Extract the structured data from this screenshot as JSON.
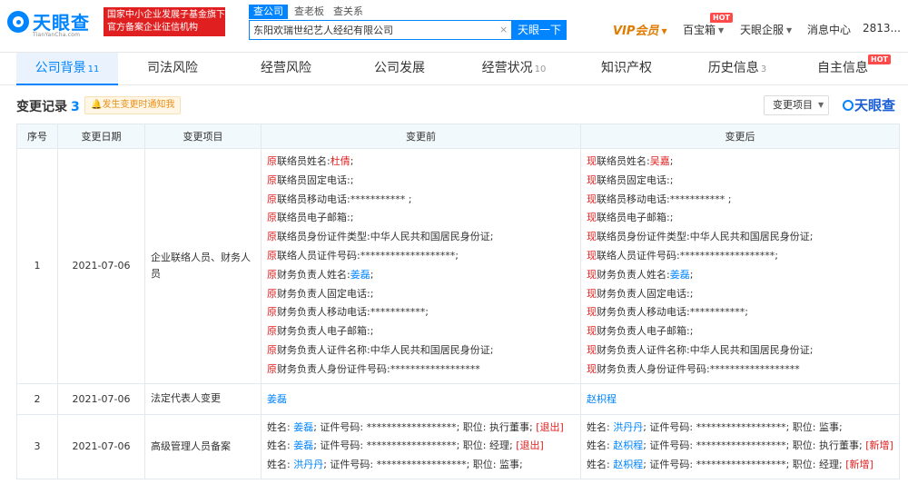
{
  "header": {
    "logo_text": "天眼查",
    "logo_sub": "TianYanCha.com",
    "banner_line1": "国家中小企业发展子基金旗下",
    "banner_line2": "官方备案企业征信机构",
    "search_tabs": [
      "查公司",
      "查老板",
      "查关系"
    ],
    "search_value": "东阳欢瑞世纪艺人经纪有限公司",
    "search_clear": "×",
    "search_button": "天眼一下",
    "nav": {
      "vip": "VIP会员",
      "treasure": "百宝箱",
      "treasure_badge": "HOT",
      "enterprise": "天眼企服",
      "messages": "消息中心",
      "user": "2813..."
    }
  },
  "tabs": [
    {
      "label": "公司背景",
      "count": "11"
    },
    {
      "label": "司法风险",
      "count": ""
    },
    {
      "label": "经营风险",
      "count": ""
    },
    {
      "label": "公司发展",
      "count": ""
    },
    {
      "label": "经营状况",
      "count": "10"
    },
    {
      "label": "知识产权",
      "count": ""
    },
    {
      "label": "历史信息",
      "count": "3"
    },
    {
      "label": "自主信息",
      "count": "",
      "badge": "HOT"
    }
  ],
  "section": {
    "title": "变更记录",
    "count": "3",
    "notify_button": "发生变更时通知我",
    "filter_button": "变更项目",
    "watermark": "天眼查"
  },
  "table": {
    "headers": [
      "序号",
      "变更日期",
      "变更项目",
      "变更前",
      "变更后"
    ],
    "rows": [
      {
        "index": "1",
        "date": "2021-07-06",
        "item": "企业联络人员、财务人员",
        "before_prefix": "原",
        "after_prefix": "现",
        "before": [
          {
            "text": "联络员姓名:",
            "name": "杜倩",
            "name_style": "red",
            "tail": ";"
          },
          {
            "text": "联络员固定电话:;"
          },
          {
            "text": "联络员移动电话:*********** ;"
          },
          {
            "text": "联络员电子邮箱:;"
          },
          {
            "text": "联络员身份证件类型:中华人民共和国居民身份证;"
          },
          {
            "text": "联络人员证件号码:*******************;"
          },
          {
            "text": "财务负责人姓名:",
            "name": "姜磊",
            "name_style": "blue",
            "tail": ";"
          },
          {
            "text": "财务负责人固定电话:;"
          },
          {
            "text": "财务负责人移动电话:***********;"
          },
          {
            "text": "财务负责人电子邮箱:;"
          },
          {
            "text": "财务负责人证件名称:中华人民共和国居民身份证;"
          },
          {
            "text": "财务负责人身份证件号码:******************"
          }
        ],
        "after": [
          {
            "text": "联络员姓名:",
            "name": "吴嘉",
            "name_style": "red",
            "tail": ";"
          },
          {
            "text": "联络员固定电话:;"
          },
          {
            "text": "联络员移动电话:*********** ;"
          },
          {
            "text": "联络员电子邮箱:;"
          },
          {
            "text": "联络员身份证件类型:中华人民共和国居民身份证;"
          },
          {
            "text": "联络人员证件号码:*******************;"
          },
          {
            "text": "财务负责人姓名:",
            "name": "姜磊",
            "name_style": "blue",
            "tail": ";"
          },
          {
            "text": "财务负责人固定电话:;"
          },
          {
            "text": "财务负责人移动电话:***********;"
          },
          {
            "text": "财务负责人电子邮箱:;"
          },
          {
            "text": "财务负责人证件名称:中华人民共和国居民身份证;"
          },
          {
            "text": "财务负责人身份证件号码:******************"
          }
        ]
      },
      {
        "index": "2",
        "date": "2021-07-06",
        "item": "法定代表人变更",
        "before_name": "姜磊",
        "after_name": "赵枳程"
      },
      {
        "index": "3",
        "date": "2021-07-06",
        "item": "高级管理人员备案",
        "before": [
          {
            "pre": "姓名: ",
            "name": "姜磊",
            "mid": "; 证件号码: ******************; 职位: 执行董事; ",
            "tag": "[退出]"
          },
          {
            "pre": "姓名: ",
            "name": "姜磊",
            "mid": "; 证件号码: ******************; 职位: 经理; ",
            "tag": "[退出]"
          },
          {
            "pre": "姓名: ",
            "name": "洪丹丹",
            "mid": "; 证件号码: ******************; 职位: 监事;",
            "tag": ""
          }
        ],
        "after": [
          {
            "pre": "姓名: ",
            "name": "洪丹丹",
            "mid": "; 证件号码: ******************; 职位: 监事;",
            "tag": ""
          },
          {
            "pre": "姓名: ",
            "name": "赵枳程",
            "mid": "; 证件号码: ******************; 职位: 执行董事; ",
            "tag": "[新增]"
          },
          {
            "pre": "姓名: ",
            "name": "赵枳程",
            "mid": "; 证件号码: ******************; 职位: 经理; ",
            "tag": "[新增]"
          }
        ]
      }
    ]
  },
  "colors": {
    "brand": "#0084ff",
    "danger": "#e02020",
    "vip": "#e07b00",
    "header_bg": "#f2f9fc"
  }
}
